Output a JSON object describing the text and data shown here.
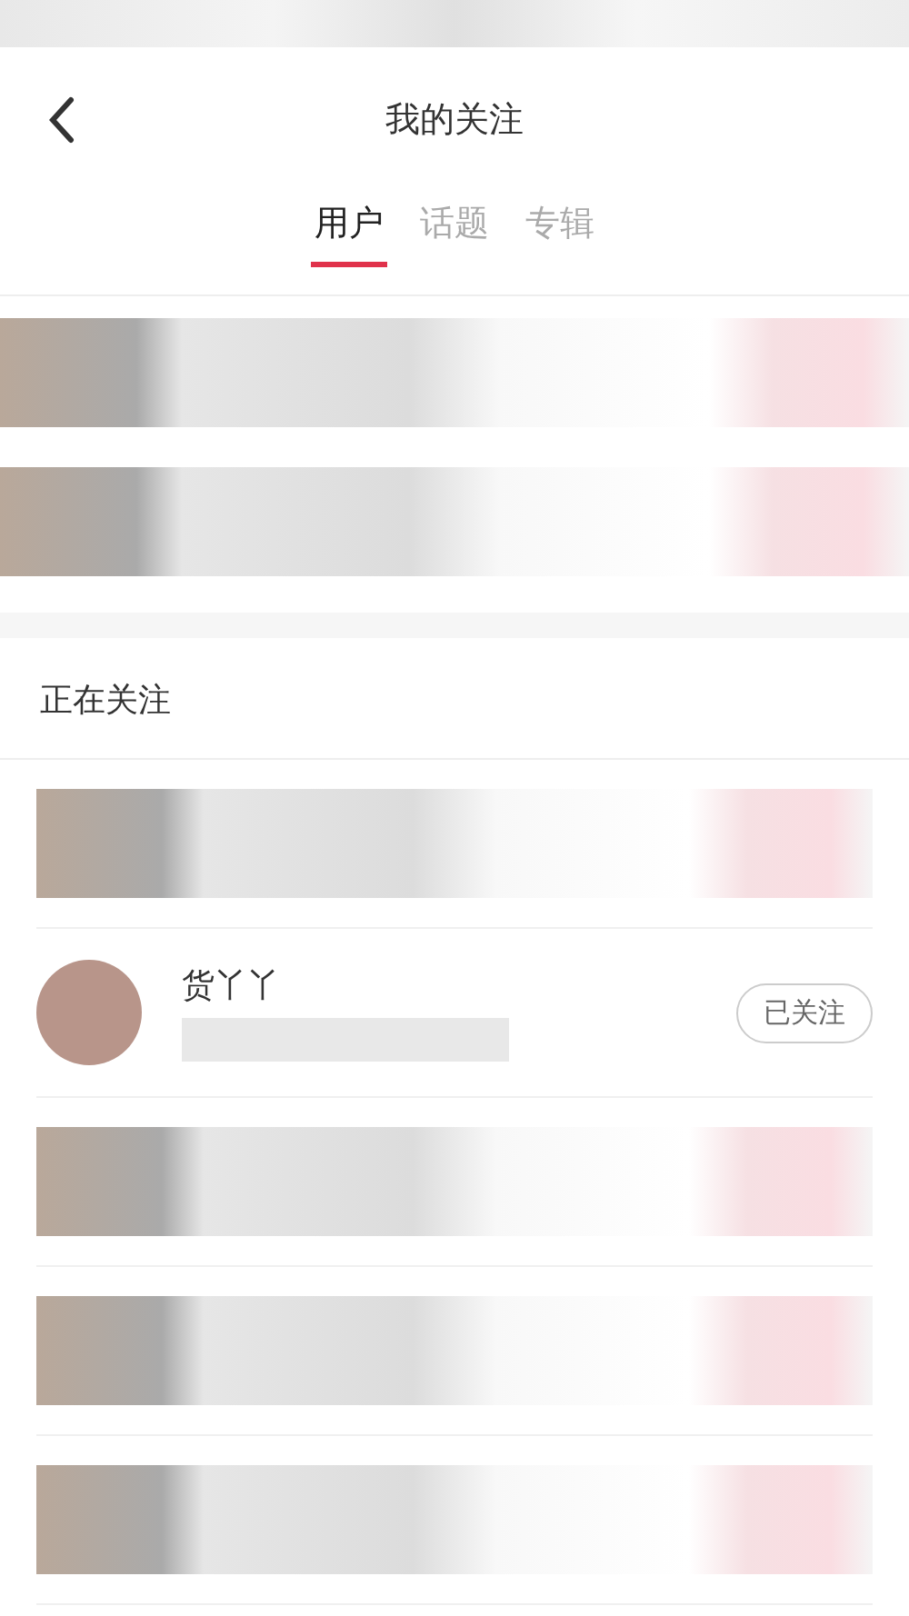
{
  "header": {
    "title": "我的关注"
  },
  "tabs": [
    {
      "label": "用户",
      "selected": true
    },
    {
      "label": "话题",
      "selected": false
    },
    {
      "label": "专辑",
      "selected": false
    }
  ],
  "following": {
    "title": "正在关注",
    "rows": [
      {
        "kind": "pixelated"
      },
      {
        "kind": "user",
        "name": "货丫丫",
        "button": "已关注"
      },
      {
        "kind": "pixelated"
      },
      {
        "kind": "pixelated"
      },
      {
        "kind": "pixelated"
      }
    ]
  }
}
